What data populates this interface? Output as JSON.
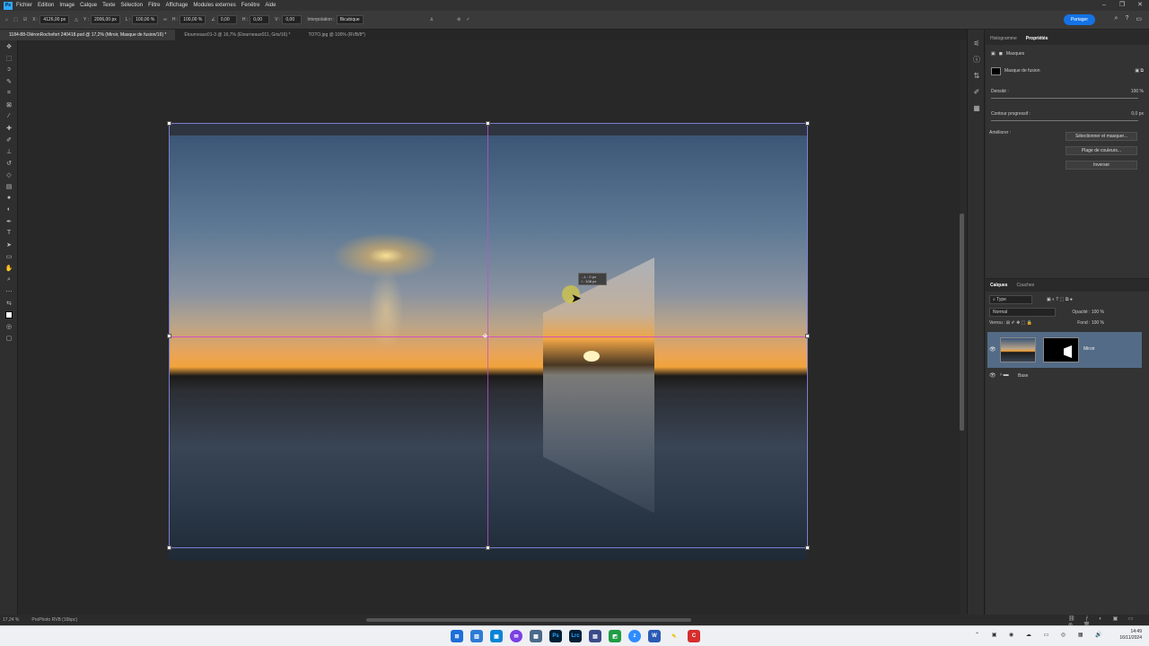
{
  "app": {
    "logo": "Ps",
    "menu": [
      "Fichier",
      "Edition",
      "Image",
      "Calque",
      "Texte",
      "Sélection",
      "Filtre",
      "Affichage",
      "Modules externes",
      "Fenêtre",
      "Aide"
    ]
  },
  "window": {
    "min": "–",
    "max": "❐",
    "close": "✕"
  },
  "options": {
    "x_label": "X :",
    "x": "4126,00 px",
    "y_label": "Y :",
    "y": "2006,00 px",
    "w_label": "L :",
    "w": "100,00 %",
    "h_label": "H :",
    "h": "100,00 %",
    "angle": "0,00",
    "hskew_label": "H :",
    "hskew": "0,00",
    "vskew_label": "V :",
    "vskew": "0,00",
    "interp_label": "Interpolation :",
    "interp": "Bicubique",
    "share": "Partager"
  },
  "tabs": [
    "1184-88-OléronRochefort 240418.psd @ 17,2% (Miroir, Masque de fusion/16) *",
    "Étourneaux01-3 @ 16,7% (Étourneaux011, Gris/16) *",
    "TOTO.jpg @ 100% (RVB/8*)"
  ],
  "tooltip": {
    "line1": "→L : 0 px",
    "line2": "↕ : 108 px"
  },
  "props": {
    "tab1": "Histogramme",
    "tab2": "Propriétés",
    "section": "Masques",
    "mask_type": "Masque de fusion",
    "density_label": "Densité :",
    "density": "100 %",
    "feather_label": "Contour progressif :",
    "feather": "0,0 px",
    "refine_label": "Améliorer :",
    "btn_select": "Sélectionner et masquer...",
    "btn_color": "Plage de couleurs...",
    "btn_invert": "Inverser"
  },
  "layers": {
    "tab1": "Calques",
    "tab2": "Couches",
    "kind": "Type",
    "blend": "Normal",
    "opacity_label": "Opacité :",
    "opacity": "100 %",
    "lock_label": "Verrou :",
    "fill_label": "Fond :",
    "fill": "100 %",
    "layer1": "Miroir",
    "layer2": "Base"
  },
  "status": {
    "zoom": "17,24 %",
    "profile": "ProPhoto RVB (16bpc)"
  },
  "taskbar": {
    "time": "14:49",
    "date": "16/11/2024"
  }
}
